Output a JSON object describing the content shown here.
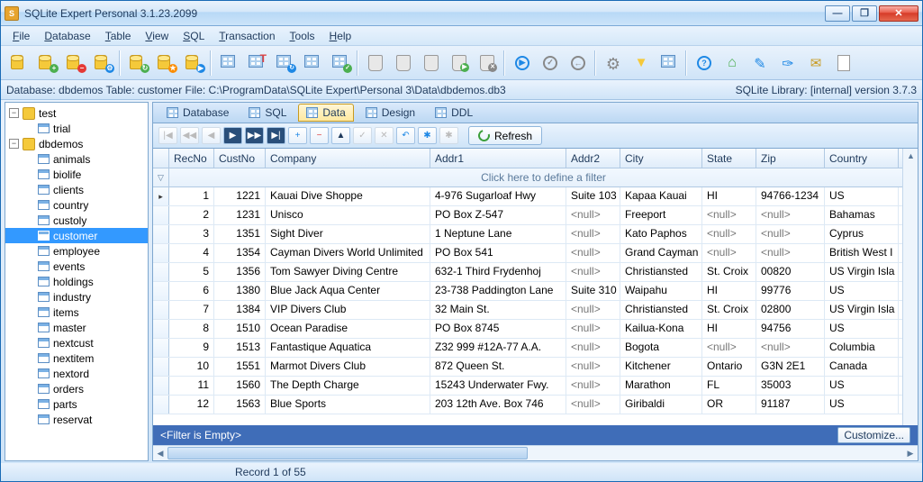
{
  "window": {
    "title": "SQLite Expert Personal 3.1.23.2099"
  },
  "menu": [
    "File",
    "Database",
    "Table",
    "View",
    "SQL",
    "Transaction",
    "Tools",
    "Help"
  ],
  "status": {
    "left": "Database: dbdemos   Table: customer   File: C:\\ProgramData\\SQLite Expert\\Personal 3\\Data\\dbdemos.db3",
    "right": "SQLite Library: [internal] version 3.7.3"
  },
  "tree": [
    {
      "type": "db",
      "name": "test",
      "expanded": true,
      "children": [
        {
          "type": "tbl",
          "name": "trial"
        }
      ]
    },
    {
      "type": "db",
      "name": "dbdemos",
      "expanded": true,
      "children": [
        {
          "type": "tbl",
          "name": "animals"
        },
        {
          "type": "tbl",
          "name": "biolife"
        },
        {
          "type": "tbl",
          "name": "clients"
        },
        {
          "type": "tbl",
          "name": "country"
        },
        {
          "type": "tbl",
          "name": "custoly"
        },
        {
          "type": "tbl",
          "name": "customer",
          "selected": true
        },
        {
          "type": "tbl",
          "name": "employee"
        },
        {
          "type": "tbl",
          "name": "events"
        },
        {
          "type": "tbl",
          "name": "holdings"
        },
        {
          "type": "tbl",
          "name": "industry"
        },
        {
          "type": "tbl",
          "name": "items"
        },
        {
          "type": "tbl",
          "name": "master"
        },
        {
          "type": "tbl",
          "name": "nextcust"
        },
        {
          "type": "tbl",
          "name": "nextitem"
        },
        {
          "type": "tbl",
          "name": "nextord"
        },
        {
          "type": "tbl",
          "name": "orders"
        },
        {
          "type": "tbl",
          "name": "parts"
        },
        {
          "type": "tbl",
          "name": "reservat"
        }
      ]
    }
  ],
  "tabs": [
    {
      "label": "Database"
    },
    {
      "label": "SQL"
    },
    {
      "label": "Data",
      "active": true
    },
    {
      "label": "Design"
    },
    {
      "label": "DDL"
    }
  ],
  "refresh_label": "Refresh",
  "filter_prompt": "Click here to define a filter",
  "filter_status": "<Filter is Empty>",
  "customize_label": "Customize...",
  "record_text": "Record 1 of 55",
  "columns": [
    "RecNo",
    "CustNo",
    "Company",
    "Addr1",
    "Addr2",
    "City",
    "State",
    "Zip",
    "Country"
  ],
  "rows": [
    {
      "RecNo": 1,
      "CustNo": 1221,
      "Company": "Kauai Dive Shoppe",
      "Addr1": "4-976 Sugarloaf Hwy",
      "Addr2": "Suite 103",
      "City": "Kapaa Kauai",
      "State": "HI",
      "Zip": "94766-1234",
      "Country": "US"
    },
    {
      "RecNo": 2,
      "CustNo": 1231,
      "Company": "Unisco",
      "Addr1": "PO Box Z-547",
      "Addr2": null,
      "City": "Freeport",
      "State": null,
      "Zip": null,
      "Country": "Bahamas"
    },
    {
      "RecNo": 3,
      "CustNo": 1351,
      "Company": "Sight Diver",
      "Addr1": "1 Neptune Lane",
      "Addr2": null,
      "City": "Kato Paphos",
      "State": null,
      "Zip": null,
      "Country": "Cyprus"
    },
    {
      "RecNo": 4,
      "CustNo": 1354,
      "Company": "Cayman Divers World Unlimited",
      "Addr1": "PO Box 541",
      "Addr2": null,
      "City": "Grand Cayman",
      "State": null,
      "Zip": null,
      "Country": "British West I"
    },
    {
      "RecNo": 5,
      "CustNo": 1356,
      "Company": "Tom Sawyer Diving Centre",
      "Addr1": "632-1 Third Frydenhoj",
      "Addr2": null,
      "City": "Christiansted",
      "State": "St. Croix",
      "Zip": "00820",
      "Country": "US Virgin Isla"
    },
    {
      "RecNo": 6,
      "CustNo": 1380,
      "Company": "Blue Jack Aqua Center",
      "Addr1": "23-738 Paddington Lane",
      "Addr2": "Suite 310",
      "City": "Waipahu",
      "State": "HI",
      "Zip": "99776",
      "Country": "US"
    },
    {
      "RecNo": 7,
      "CustNo": 1384,
      "Company": "VIP Divers Club",
      "Addr1": "32 Main St.",
      "Addr2": null,
      "City": "Christiansted",
      "State": "St. Croix",
      "Zip": "02800",
      "Country": "US Virgin Isla"
    },
    {
      "RecNo": 8,
      "CustNo": 1510,
      "Company": "Ocean Paradise",
      "Addr1": "PO Box 8745",
      "Addr2": null,
      "City": "Kailua-Kona",
      "State": "HI",
      "Zip": "94756",
      "Country": "US"
    },
    {
      "RecNo": 9,
      "CustNo": 1513,
      "Company": "Fantastique Aquatica",
      "Addr1": "Z32 999 #12A-77 A.A.",
      "Addr2": null,
      "City": "Bogota",
      "State": null,
      "Zip": null,
      "Country": "Columbia"
    },
    {
      "RecNo": 10,
      "CustNo": 1551,
      "Company": "Marmot Divers Club",
      "Addr1": "872 Queen St.",
      "Addr2": null,
      "City": "Kitchener",
      "State": "Ontario",
      "Zip": "G3N 2E1",
      "Country": "Canada"
    },
    {
      "RecNo": 11,
      "CustNo": 1560,
      "Company": "The Depth Charge",
      "Addr1": "15243 Underwater Fwy.",
      "Addr2": null,
      "City": "Marathon",
      "State": "FL",
      "Zip": "35003",
      "Country": "US"
    },
    {
      "RecNo": 12,
      "CustNo": 1563,
      "Company": "Blue Sports",
      "Addr1": "203 12th Ave. Box 746",
      "Addr2": null,
      "City": "Giribaldi",
      "State": "OR",
      "Zip": "91187",
      "Country": "US"
    }
  ]
}
